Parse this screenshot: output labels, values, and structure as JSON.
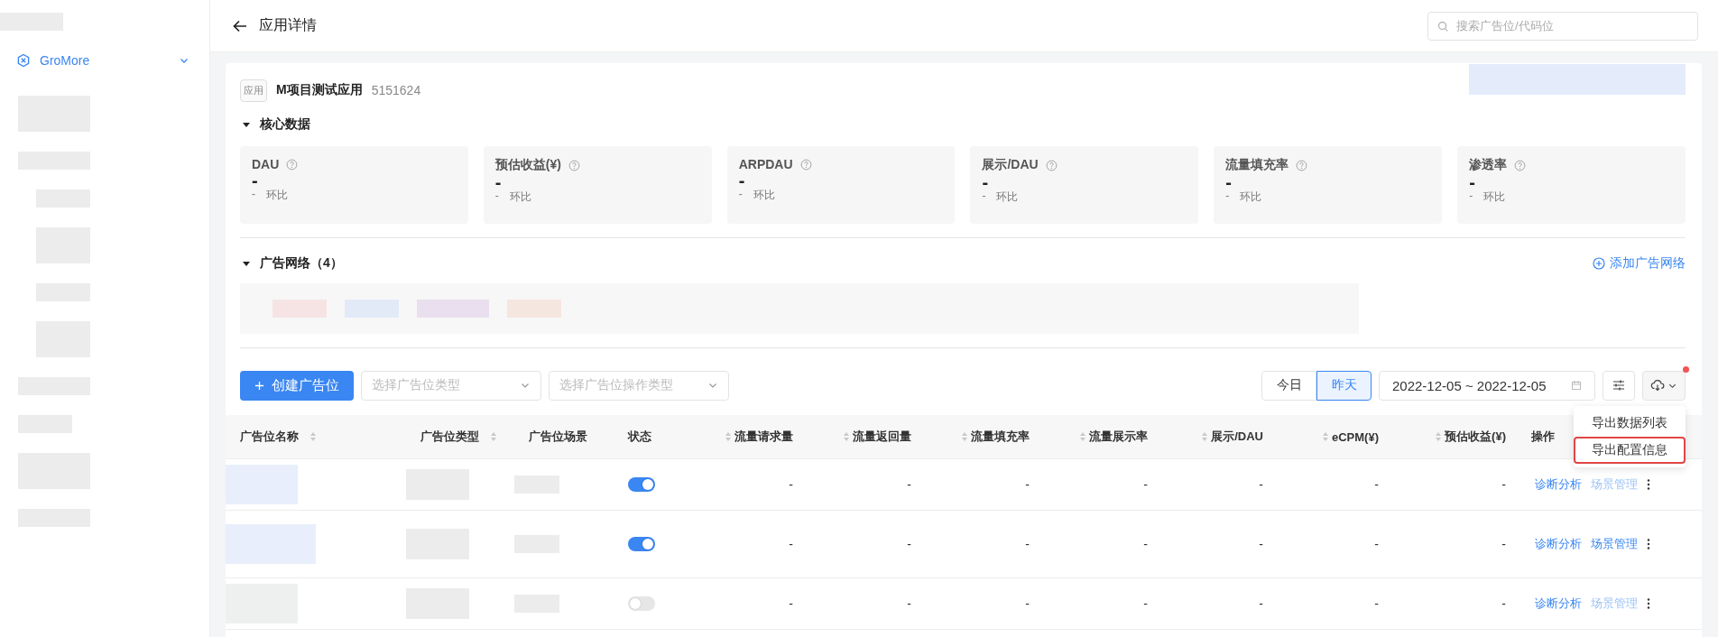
{
  "header": {
    "title": "应用详情",
    "search": {
      "placeholder": "搜索广告位/代码位"
    }
  },
  "sidebar": {
    "items": [
      {
        "label": "GroMore",
        "expanded": true
      }
    ]
  },
  "app": {
    "tag": "应用",
    "name": "M项目测试应用",
    "id": "5151624"
  },
  "core": {
    "title": "核心数据",
    "expanded": true,
    "metrics": [
      {
        "label": "DAU",
        "value": "-",
        "change": "-",
        "change_label": "环比"
      },
      {
        "label": "预估收益(¥)",
        "value": "-",
        "change": "-",
        "change_label": "环比"
      },
      {
        "label": "ARPDAU",
        "value": "-",
        "change": "-",
        "change_label": "环比"
      },
      {
        "label": "展示/DAU",
        "value": "-",
        "change": "-",
        "change_label": "环比"
      },
      {
        "label": "流量填充率",
        "value": "-",
        "change": "-",
        "change_label": "环比"
      },
      {
        "label": "渗透率",
        "value": "-",
        "change": "-",
        "change_label": "环比"
      }
    ]
  },
  "networks": {
    "title": "广告网络（4）",
    "expanded": true,
    "add": "添加广告网络"
  },
  "toolbar": {
    "create": "创建广告位",
    "filters": [
      {
        "placeholder": "选择广告位类型"
      },
      {
        "placeholder": "选择广告位操作类型"
      }
    ],
    "ranges": [
      {
        "label": "今日",
        "selected": false
      },
      {
        "label": "昨天",
        "selected": true
      }
    ],
    "date_range": "2022-12-05 ~ 2022-12-05",
    "export_badge": true
  },
  "export_menu": {
    "items": [
      {
        "label": "导出数据列表",
        "highlighted": false
      },
      {
        "label": "导出配置信息",
        "highlighted": true
      }
    ]
  },
  "table": {
    "columns": [
      {
        "label": "广告位名称",
        "kind": "text",
        "sortable": true
      },
      {
        "label": "广告位类型",
        "kind": "text",
        "sortable": true
      },
      {
        "label": "广告位场景",
        "kind": "text",
        "sortable": false
      },
      {
        "label": "状态",
        "kind": "text",
        "sortable": false
      },
      {
        "label": "流量请求量",
        "kind": "number",
        "sortable": true
      },
      {
        "label": "流量返回量",
        "kind": "number",
        "sortable": true
      },
      {
        "label": "流量填充率",
        "kind": "number",
        "sortable": true
      },
      {
        "label": "流量展示率",
        "kind": "number",
        "sortable": true
      },
      {
        "label": "展示/DAU",
        "kind": "number",
        "sortable": true
      },
      {
        "label": "eCPM(¥)",
        "kind": "number",
        "sortable": true
      },
      {
        "label": "预估收益(¥)",
        "kind": "number",
        "sortable": true
      },
      {
        "label": "操作",
        "kind": "text",
        "sortable": false
      }
    ],
    "rows": [
      {
        "enabled": true,
        "cells": [
          "",
          "",
          "",
          "",
          "-",
          "-",
          "-",
          "-",
          "-",
          "-",
          "-"
        ],
        "actions": [
          {
            "label": "诊断分析",
            "disabled": false
          },
          {
            "label": "场景管理",
            "disabled": true
          }
        ]
      },
      {
        "enabled": true,
        "cells": [
          "",
          "",
          "",
          "",
          "-",
          "-",
          "-",
          "-",
          "-",
          "-",
          "-"
        ],
        "actions": [
          {
            "label": "诊断分析",
            "disabled": false
          },
          {
            "label": "场景管理",
            "disabled": false
          }
        ]
      },
      {
        "enabled": false,
        "cells": [
          "",
          "",
          "",
          "",
          "-",
          "-",
          "-",
          "-",
          "-",
          "-",
          "-"
        ],
        "actions": [
          {
            "label": "诊断分析",
            "disabled": false
          },
          {
            "label": "场景管理",
            "disabled": true
          }
        ]
      }
    ]
  }
}
